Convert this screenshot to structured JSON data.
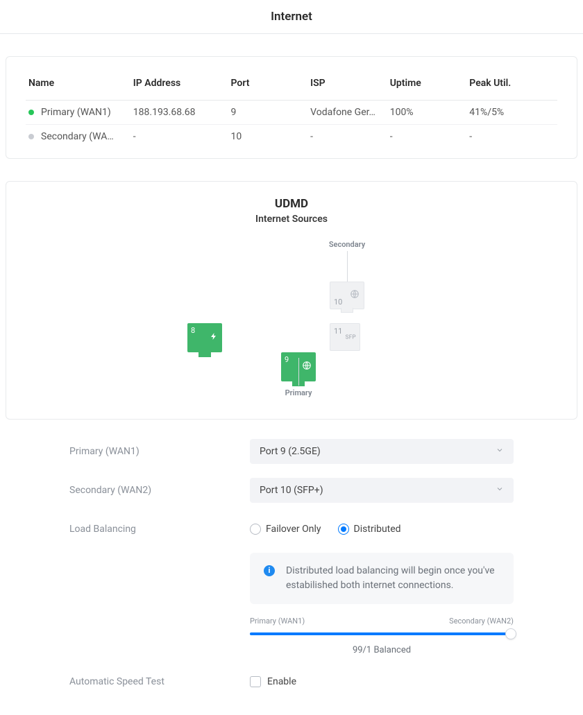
{
  "header": {
    "title": "Internet"
  },
  "wan_table": {
    "columns": [
      "Name",
      "IP Address",
      "Port",
      "ISP",
      "Uptime",
      "Peak Util."
    ],
    "rows": [
      {
        "status": "green",
        "name": "Primary (WAN1)",
        "ip": "188.193.68.68",
        "port": "9",
        "isp": "Vodafone Ger…",
        "uptime": "100%",
        "peak": "41%/5%"
      },
      {
        "status": "gray",
        "name": "Secondary (WA…",
        "ip": "-",
        "port": "10",
        "isp": "-",
        "uptime": "-",
        "peak": "-"
      }
    ]
  },
  "diagram": {
    "device_name": "UDMD",
    "subtitle": "Internet Sources",
    "primary_label": "Primary",
    "secondary_label": "Secondary",
    "ports": {
      "p8": {
        "num": "8"
      },
      "p9": {
        "num": "9"
      },
      "p10": {
        "num": "10"
      },
      "p11": {
        "num": "11",
        "sfp": "SFP"
      }
    }
  },
  "form": {
    "primary_label": "Primary (WAN1)",
    "primary_value": "Port 9 (2.5GE)",
    "secondary_label": "Secondary (WAN2)",
    "secondary_value": "Port 10 (SFP+)",
    "lb_label": "Load Balancing",
    "lb_options": {
      "failover": "Failover Only",
      "distributed": "Distributed"
    },
    "lb_selected": "distributed",
    "info_text": "Distributed load balancing will begin once you've estabilished both internet connections.",
    "slider": {
      "left_label": "Primary (WAN1)",
      "right_label": "Secondary (WAN2)",
      "fill_percent": 99,
      "caption": "99/1 Balanced"
    },
    "ast_label": "Automatic Speed Test",
    "ast_checkbox_label": "Enable",
    "ast_checked": false
  },
  "colors": {
    "accent": "#007aff",
    "port_active": "#3fb66a"
  }
}
